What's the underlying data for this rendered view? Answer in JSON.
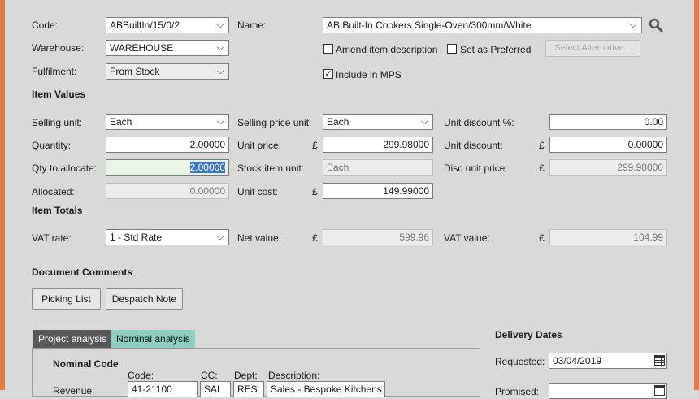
{
  "colors": {
    "frame": "#e87a45",
    "tab_active": "#57585a",
    "tab_alt": "#8fcfc0"
  },
  "product": {
    "code_label": "Code:",
    "code_value": "ABBuiltIn/15/0/2",
    "name_label": "Name:",
    "name_value": "AB Built-In Cookers Single-Oven/300mm/White",
    "warehouse_label": "Warehouse:",
    "warehouse_value": "WAREHOUSE",
    "fulfilment_label": "Fulfilment:",
    "fulfilment_value": "From Stock",
    "amend_label": "Amend item description",
    "amend_checked": false,
    "preferred_label": "Set as Preferred",
    "preferred_checked": false,
    "select_alt_label": "Select Alternative...",
    "mps_label": "Include in MPS",
    "mps_checked": true,
    "search_icon": "search-icon"
  },
  "item_values": {
    "heading": "Item Values",
    "selling_unit_label": "Selling unit:",
    "selling_unit_value": "Each",
    "selling_price_unit_label": "Selling price unit:",
    "selling_price_unit_value": "Each",
    "unit_discount_pct_label": "Unit discount %:",
    "unit_discount_pct_value": "0.00",
    "quantity_label": "Quantity:",
    "quantity_value": "2.00000",
    "unit_price_label": "Unit price:",
    "unit_price_value": "299.98000",
    "unit_discount_label": "Unit discount:",
    "unit_discount_value": "0.00000",
    "qty_allocate_label": "Qty to allocate:",
    "qty_allocate_value": "2.00000",
    "stock_item_unit_label": "Stock item unit:",
    "stock_item_unit_value": "Each",
    "disc_unit_price_label": "Disc unit price:",
    "disc_unit_price_value": "299.98000",
    "allocated_label": "Allocated:",
    "allocated_value": "0.00000",
    "unit_cost_label": "Unit cost:",
    "unit_cost_value": "149.99000",
    "currency": "£"
  },
  "item_totals": {
    "heading": "Item Totals",
    "vat_rate_label": "VAT rate:",
    "vat_rate_value": "1 - Std Rate",
    "net_value_label": "Net value:",
    "net_value_value": "599.96",
    "vat_value_label": "VAT value:",
    "vat_value_value": "104.99"
  },
  "document_comments": {
    "heading": "Document Comments",
    "picking_list": "Picking List",
    "despatch_note": "Despatch Note"
  },
  "analysis": {
    "tabs": [
      "Project analysis",
      "Nominal analysis"
    ],
    "nominal_heading": "Nominal Code",
    "columns": [
      "Code:",
      "CC:",
      "Dept:",
      "Description:"
    ],
    "row_label": "Revenue:",
    "row_code": "41-21100",
    "row_cc": "SAL",
    "row_dept": "RES",
    "row_desc": "Sales - Bespoke Kitchens"
  },
  "delivery": {
    "heading": "Delivery Dates",
    "requested_label": "Requested:",
    "requested_value": "03/04/2019",
    "promised_label": "Promised:"
  }
}
